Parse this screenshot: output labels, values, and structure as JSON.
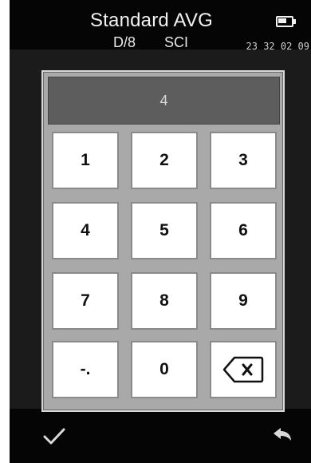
{
  "header": {
    "title": "Standard AVG",
    "mode": "D/8",
    "component": "SCI",
    "time": "23 32 02 09"
  },
  "keypad": {
    "display_value": "4",
    "keys": [
      "1",
      "2",
      "3",
      "4",
      "5",
      "6",
      "7",
      "8",
      "9",
      "-.",
      "0"
    ]
  },
  "icons": {
    "battery": "battery-icon",
    "backspace": "backspace-icon",
    "confirm": "check-icon",
    "back": "back-arrow-icon"
  },
  "colors": {
    "background": "#000000",
    "keypad_frame": "#a9a9a9",
    "display": "#5d5d5d",
    "key": "#ffffff",
    "text_light": "#f2f2f2"
  }
}
